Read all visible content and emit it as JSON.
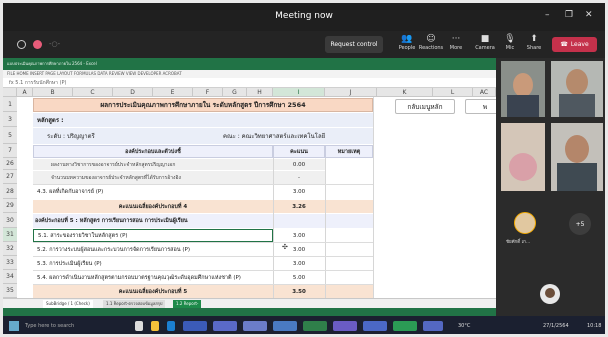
{
  "window": {
    "title": "Meeting now",
    "controls": [
      "–",
      "❐",
      "✕"
    ]
  },
  "toolbar": {
    "request_control": "Request control",
    "small_text": "-○-",
    "people": "People",
    "reactions": "Reactions",
    "more": "More",
    "camera": "Camera",
    "mic": "Mic",
    "share": "Share",
    "leave": "Leave",
    "leave_color": "#c4314b"
  },
  "excel": {
    "ribbon_text": "แบบประเมินคุณภาพการศึกษาภายใน 2564 - Excel",
    "menus": "FILE   HOME   INSERT   PAGE LAYOUT   FORMULAS   DATA   REVIEW   VIEW   DEVELOPER   ACROBAT",
    "formula_bar": "fx   5.1 การรับนักศึกษา (P)",
    "columns": [
      "A",
      "B",
      "C",
      "D",
      "E",
      "F",
      "G",
      "H",
      "I",
      "J",
      "K",
      "L",
      "AC"
    ],
    "rows": [
      {
        "num": "1",
        "text": "ผลการประเมินคุณภาพการศึกษาภายใน ระดับหลักสูตร ปีการศึกษา 2564"
      },
      {
        "num": "3",
        "text": "หลักสูตร :"
      },
      {
        "num": "5",
        "label": "ระดับ : ปริญญาตรี",
        "label2": "คณะ : คณะวิทยาศาสตร์และเทคโนโลยี"
      },
      {
        "num": "7",
        "col1": "องค์ประกอบและตัวบ่งชี้",
        "col2": "คะแนน",
        "col3": "หมายเหตุ"
      },
      {
        "num": "26",
        "text": "ผลงานทางวิชาการของอาจารย์ประจำหลักสูตรปริญญาเอก",
        "score": "0.00"
      },
      {
        "num": "27",
        "text": "จำนวนบทความของอาจารย์ประจำหลักสูตรที่ได้รับการอ้างอิง",
        "score": "-"
      },
      {
        "num": "28",
        "text": "4.3. ผลที่เกิดกับอาจารย์ (P)",
        "score": "3.00"
      },
      {
        "num": "29",
        "text": "คะแนนเฉลี่ยองค์ประกอบที่ 4",
        "score": "3.26"
      },
      {
        "num": "30",
        "text": "องค์ประกอบที่ 5 : หลักสูตร การเรียนการสอน การประเมินผู้เรียน"
      },
      {
        "num": "31",
        "text": "5.1. สาระของรายวิชาในหลักสูตร (P)",
        "score": "3.00"
      },
      {
        "num": "32",
        "text": "5.2. การวางระบบผู้สอนและกระบวนการจัดการเรียนการสอน (P)",
        "score": "3.00"
      },
      {
        "num": "33",
        "text": "5.3. การประเมินผู้เรียน (P)",
        "score": "3.00"
      },
      {
        "num": "34",
        "text": "5.4. ผลการดำเนินงานหลักสูตรตามกรอบมาตรฐานคุณวุฒิระดับอุดมศึกษาแห่งชาติ (P)",
        "score": "5.00"
      },
      {
        "num": "35",
        "text": "คะแนนเฉลี่ยองค์ประกอบที่ 5",
        "score": "3.50"
      }
    ],
    "buttons": {
      "main_menu": "กลับเมนูหลัก",
      "partial": "พ"
    },
    "sheet_tabs": [
      "SubBridge / 1 (Check)",
      "1.1 Report-ตรวจสอบข้อมูลสรุป",
      "1.2 Report-"
    ]
  },
  "panel": {
    "participant_name": "ชัยศักดิ์ เก...",
    "more_count": "+5"
  },
  "taskbar": {
    "search": "Type here to search",
    "weather": "30°C",
    "time": "10:18",
    "date": "27/1/2564"
  },
  "colors": {
    "excel_green": "#217346",
    "title_cell": "#f9d8c4",
    "subtitle_cell": "#eaeef8",
    "score_total": "#f9e3d2",
    "section_header": "#eef0fb"
  }
}
